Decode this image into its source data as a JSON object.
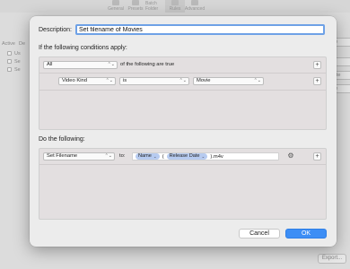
{
  "background": {
    "tabs": [
      "General",
      "Presets",
      "Batch Folder",
      "Rules",
      "Advanced"
    ],
    "selected_tab": "Rules",
    "list_header": [
      "Active",
      "De"
    ],
    "list_rows": [
      "Us",
      "Se",
      "Se"
    ],
    "right_buttons": [
      "ule",
      "",
      "cate",
      "ule"
    ],
    "export_label": "Export..."
  },
  "sheet": {
    "description_label": "Description:",
    "description_value": "Set filename of Movies",
    "conditions_label": "If the following conditions apply:",
    "match_popup": "All",
    "match_suffix": "of the following are true",
    "condition": {
      "field": "Video Kind",
      "operator": "is",
      "value": "Movie"
    },
    "actions_label": "Do the following:",
    "action": {
      "type": "Set Filename",
      "to_label": "to:",
      "tokens": [
        "Name",
        "Release Date"
      ],
      "open_paren": "(",
      "suffix": ").m4v"
    },
    "plus_symbol": "+",
    "popup_arrows": "⌃⌄",
    "token_chevron": "⌄",
    "gear_glyph": "⚙",
    "cancel_label": "Cancel",
    "ok_label": "OK"
  }
}
